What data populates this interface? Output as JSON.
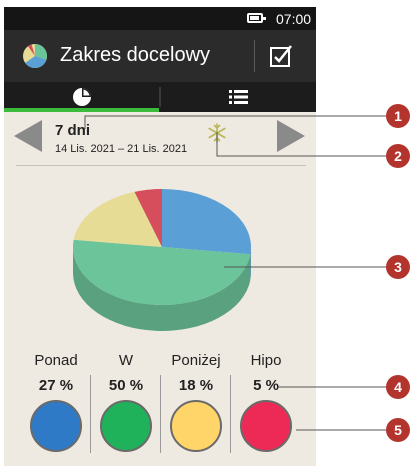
{
  "status_bar": {
    "time": "07:00"
  },
  "header": {
    "title": "Zakres docelowy"
  },
  "tabs": [
    {
      "icon": "pie-chart-icon"
    },
    {
      "icon": "list-icon"
    }
  ],
  "period": {
    "label": "7 dni",
    "range": "14 Lis. 2021 – 21 Lis. 2021"
  },
  "chart_data": {
    "type": "pie",
    "categories": [
      "Ponad",
      "W",
      "Poniżej",
      "Hipo"
    ],
    "values": [
      27,
      50,
      18,
      5
    ],
    "colors": [
      "#5aa0d6",
      "#6cc49b",
      "#e6dc96",
      "#d64e5b"
    ]
  },
  "legend": [
    {
      "label": "Ponad",
      "value": "27 %",
      "color": "#2f7ac6"
    },
    {
      "label": "W",
      "value": "50 %",
      "color": "#1fb25a"
    },
    {
      "label": "Poniżej",
      "value": "18 %",
      "color": "#ffd56a"
    },
    {
      "label": "Hipo",
      "value": "5 %",
      "color": "#ed2a55"
    }
  ],
  "callouts": [
    "1",
    "2",
    "3",
    "4",
    "5"
  ]
}
